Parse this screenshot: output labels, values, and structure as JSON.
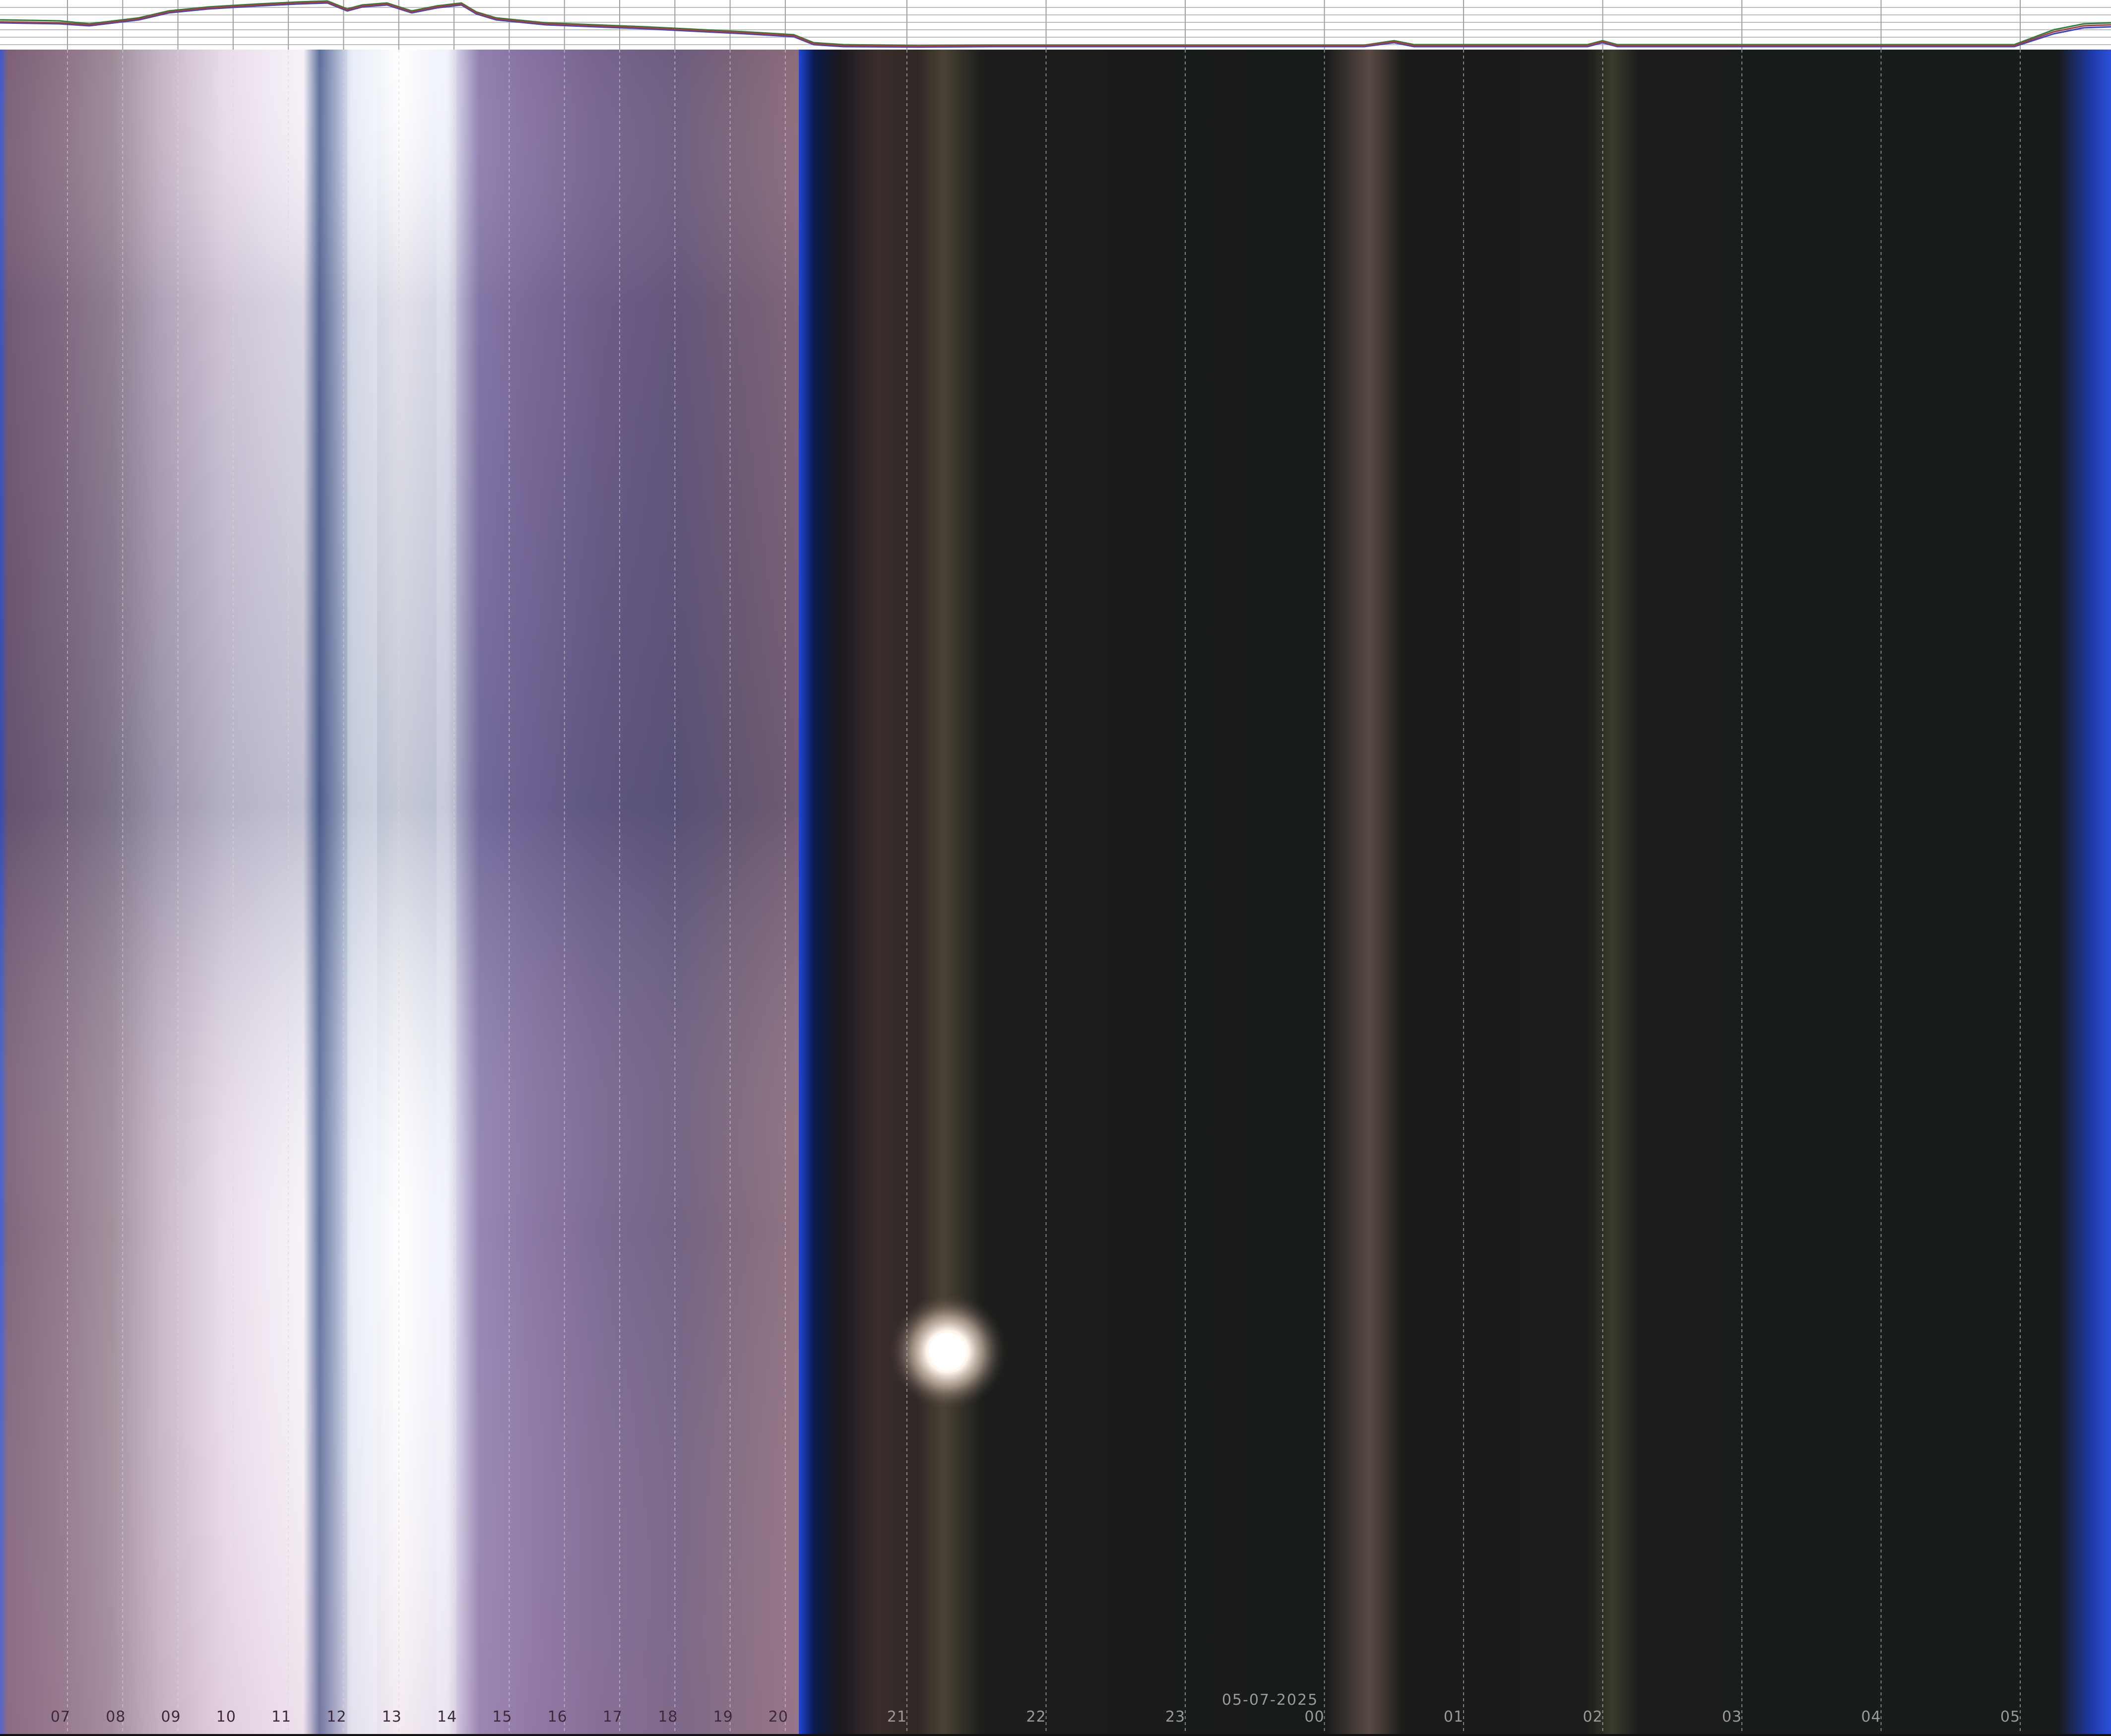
{
  "date_label": "05-07-2025",
  "hour_labels": [
    "07",
    "08",
    "09",
    "10",
    "11",
    "12",
    "13",
    "14",
    "15",
    "16",
    "17",
    "18",
    "19",
    "20",
    "21",
    "22",
    "23",
    "00",
    "01",
    "02",
    "03",
    "04",
    "05"
  ],
  "colors": {
    "day_pink": "#8a6a84",
    "day_white": "#eceaf2",
    "twilight_blue": "#2a4fd6",
    "night": "#15181a",
    "night_band": "#6a5a4e"
  }
}
